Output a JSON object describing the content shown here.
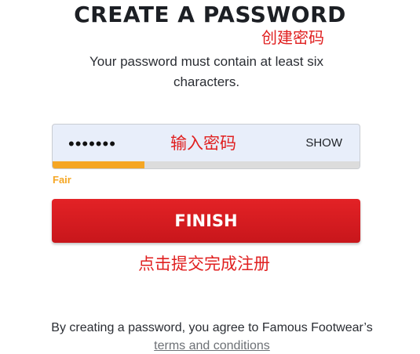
{
  "header": {
    "title": "CREATE A PASSWORD",
    "annotation": "创建密码"
  },
  "subtitle": "Your password must contain at least six characters.",
  "password_field": {
    "value": "•••••••",
    "show_label": "SHOW",
    "annotation": "输入密码",
    "strength_label": "Fair",
    "strength_fraction": 0.3
  },
  "finish": {
    "label": "FINISH",
    "annotation": "点击提交完成注册"
  },
  "terms": {
    "text": "By creating a password, you agree to Famous Footwear’s",
    "link_label": "terms and conditions"
  },
  "colors": {
    "accent": "#d81c21",
    "strength": "#f5a623",
    "annotation": "#e02020"
  }
}
